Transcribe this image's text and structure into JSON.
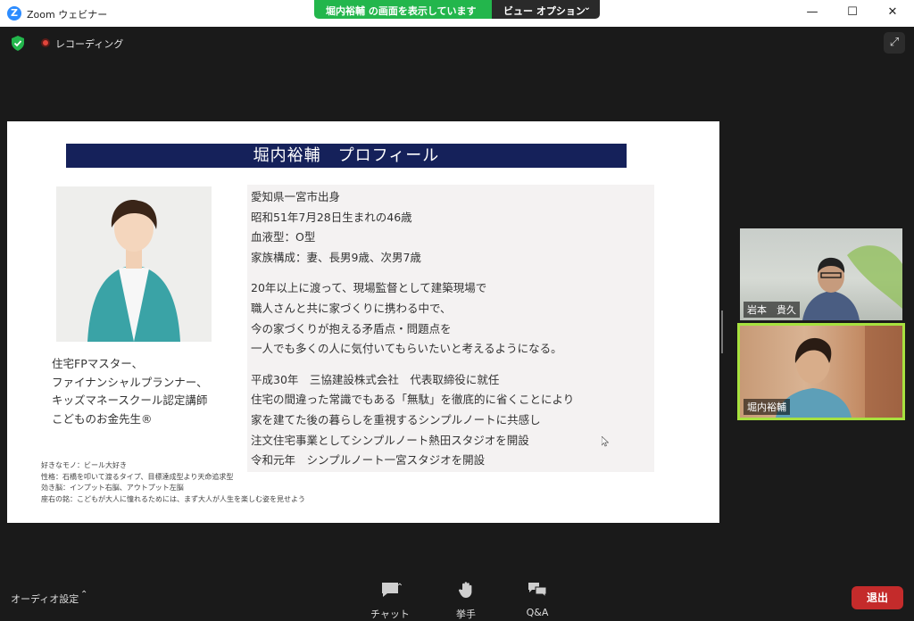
{
  "window": {
    "app_title": "Zoom ウェビナー",
    "share_banner": {
      "text": "堀内裕輔 の画面を表示しています",
      "view_options": "ビュー オプション"
    },
    "controls": {
      "minimize": "—",
      "maximize": "☐",
      "close": "✕"
    }
  },
  "topbar": {
    "recording_label": "レコーディング"
  },
  "slide": {
    "title": "堀内裕輔　プロフィール",
    "roles": [
      "住宅FPマスター、",
      "ファイナンシャルプランナー、",
      "キッズマネースクール認定講師",
      "こどものお金先生®"
    ],
    "notes": [
      "好きなモノ：ビール大好き",
      "性格：石橋を叩いて渡るタイプ、目標達成型より天命追求型",
      "効き脳：インプット右脳、アウトプット左脳",
      "座右の銘：こどもが大人に憧れるためには、まず大人が人生を楽しむ姿を見せよう"
    ],
    "profile_block_1": [
      "愛知県一宮市出身",
      "昭和51年7月28日生まれの46歳",
      "血液型：O型",
      "家族構成：妻、長男9歳、次男7歳"
    ],
    "profile_block_2": [
      "20年以上に渡って、現場監督として建築現場で",
      "職人さんと共に家づくりに携わる中で、",
      "今の家づくりが抱える矛盾点・問題点を",
      "一人でも多くの人に気付いてもらいたいと考えるようになる。"
    ],
    "profile_block_3": [
      "平成30年　三協建設株式会社　代表取締役に就任",
      "住宅の間違った常識でもある「無駄」を徹底的に省くことにより",
      "家を建てた後の暮らしを重視するシンプルノートに共感し",
      "注文住宅事業としてシンプルノート熱田スタジオを開設",
      "令和元年　シンプルノート一宮スタジオを開設"
    ]
  },
  "participants": [
    {
      "name": "岩本　貴久"
    },
    {
      "name": "堀内裕輔"
    }
  ],
  "bottombar": {
    "audio_settings": "オーディオ設定",
    "chat": "チャット",
    "raise_hand": "挙手",
    "qa": "Q&A",
    "leave": "退出"
  },
  "colors": {
    "share_green": "#23b64c",
    "slide_header": "#15215a",
    "leave_red": "#c42b2b",
    "active_speaker": "#a7e13f"
  }
}
